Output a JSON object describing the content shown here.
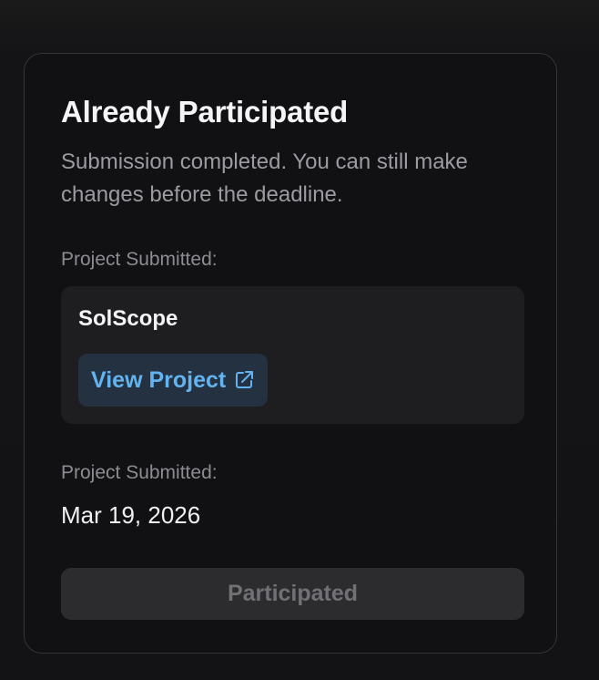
{
  "card": {
    "title": "Already Participated",
    "subtitle": "Submission completed. You can still make changes before the deadline.",
    "project_label": "Project Submitted:",
    "project": {
      "name": "SolScope",
      "view_button_label": "View Project",
      "view_button_icon": "external-link-icon"
    },
    "date_label": "Project Submitted:",
    "date_value": "Mar 19, 2026",
    "status_button_label": "Participated",
    "status_button_disabled": true
  },
  "colors": {
    "background": "#131315",
    "card_background": "#111113",
    "card_border": "#34343a",
    "project_box_background": "#1e1e21",
    "accent": "#63b3f0",
    "accent_background": "#243140",
    "disabled_button_background": "#2c2c2f",
    "disabled_button_text": "#707075",
    "primary_text": "#f5f5f7",
    "secondary_text": "#9b9ba1"
  }
}
